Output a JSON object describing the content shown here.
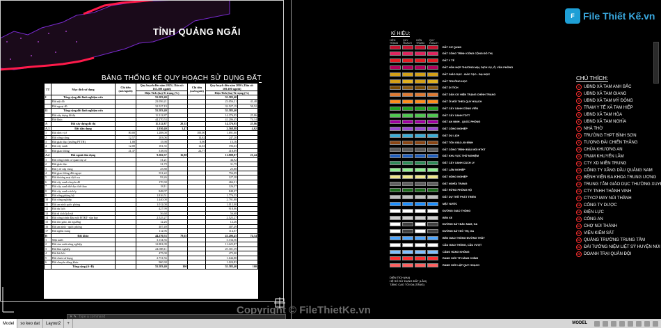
{
  "map": {
    "province_title": "TỈNH QUẢNG NGÃI",
    "table_title": "BẢNG THỐNG KÊ QUY HOẠCH SỬ DỤNG ĐẤT"
  },
  "table": {
    "headers": {
      "stt": "TT",
      "purpose": "Mục đích sử dụng",
      "norm1": "Chỉ tiêu (m2/người)",
      "plan2025": "Quy hoạch đến năm 2025 ( Dân số: 161.100 người)",
      "norm2": "Chỉ tiêu (m2/người)",
      "plan2030": "Quy hoạch đến năm 2030 ( Dân số: 169.100 người)",
      "area_pct": "Diện Tích (ha) Tỉ trọng (%)"
    },
    "rows": [
      [
        "I",
        "Tổng cộng đất lãnh nghiệm cứu",
        "",
        "55.583,40",
        "",
        "",
        "55.583,40",
        "",
        true
      ],
      [
        "",
        "Đất nội đô",
        "",
        "23.056,21",
        "",
        "",
        "23.056,21",
        "41,48",
        false
      ],
      [
        "",
        "Đất ngoại đô",
        "",
        "32.527,19",
        "",
        "",
        "32.527,19",
        "58,52",
        false
      ],
      [
        "II",
        "Tổng cộng đất lãnh nghiệm cứu",
        "",
        "55.583,40",
        "",
        "",
        "55.583,40",
        "",
        true
      ],
      [
        "",
        "Đất xây dựng đô thị",
        "",
        "11.312,87",
        "",
        "",
        "14.376,95",
        "25,86",
        false
      ],
      [
        "",
        "Đất khác",
        "",
        "44.270,53",
        "",
        "",
        "41.206,45",
        "74,14",
        false
      ],
      [
        "A",
        "Đất xây dựng đô thị",
        "",
        "11.312,87",
        "20,35",
        "",
        "14.376,95",
        "25,86",
        true
      ],
      [
        "A.1",
        "Đất dân dụng",
        "",
        "1.930,40",
        "3,47",
        "",
        "2.568,88",
        "4,62",
        true
      ],
      [
        "1",
        "Đất đơn vị ở",
        "80,00",
        "1.288,00",
        "",
        "100,00",
        "1.691,00",
        "",
        false
      ],
      [
        "2",
        "Đất công cộng",
        "12,57",
        "203,06",
        "",
        "14,62",
        "247,20",
        "",
        false
      ],
      [
        "3",
        "Đất giáo dục (trường PTTH)",
        "1,00",
        "15,98",
        "",
        "0,90",
        "15,16",
        "",
        false
      ],
      [
        "4",
        "Đất cây xanh",
        "12,00",
        "181,35",
        "",
        "12,63",
        "196,63",
        "",
        false
      ],
      [
        "5",
        "Đất giao thông",
        "21,37",
        "318,93",
        "",
        "24,77",
        "418,89",
        "",
        false
      ],
      [
        "A.2",
        "Đất ngoài dân dụng",
        "",
        "9.382,37",
        "16,88",
        "",
        "11.808,07",
        "21,24",
        true
      ],
      [
        "1",
        "Đất công trình cơ quan trụ sở",
        "",
        "31,21",
        "",
        "",
        "44,92",
        "",
        false
      ],
      [
        "2",
        "Đất giáo dục",
        "",
        "31,79",
        "",
        "",
        "31,79",
        "",
        false
      ],
      [
        "3",
        "Đất y tế cấp vùng",
        "",
        "25,88",
        "",
        "",
        "25,88",
        "",
        false
      ],
      [
        "4",
        "Đất giao thông đối ngoại",
        "",
        "551,22",
        "",
        "",
        "756,09",
        "",
        false
      ],
      [
        "5",
        "Đất thương mại dịch vụ",
        "",
        "93,26",
        "",
        "",
        "127,38",
        "",
        false
      ],
      [
        "6",
        "Đất cây xanh chuyên đề",
        "",
        "170,30",
        "",
        "",
        "466,31",
        "",
        false
      ],
      [
        "7",
        "Đất cây xanh thể dục thể thao",
        "",
        "18,11",
        "",
        "",
        "126,57",
        "",
        false
      ],
      [
        "8",
        "Đất cây xanh cách ly",
        "",
        "848,07",
        "",
        "",
        "848,07",
        "",
        false
      ],
      [
        "9",
        "Đất rừng phòng hộ",
        "",
        "1.816,51",
        "",
        "",
        "1.776,55",
        "",
        false
      ],
      [
        "10",
        "Đất công nghiệp",
        "",
        "1.440,00",
        "",
        "",
        "2.791,88",
        "",
        false
      ],
      [
        "11",
        "Đất an ninh quốc phòng",
        "",
        "1.012,00",
        "",
        "",
        "1.012,00",
        "",
        false
      ],
      [
        "12",
        "Đất du lịch",
        "",
        "427,99",
        "",
        "",
        "918,86",
        "",
        false
      ],
      [
        "13",
        "Đất di tích lịch sử",
        "",
        "56,68",
        "",
        "",
        "56,68",
        "",
        false
      ],
      [
        "14",
        "Đất công trình đầu mối HTKT- sân bay",
        "",
        "2.525,27",
        "",
        "",
        "2.525,27",
        "",
        false
      ],
      [
        "15",
        "Đất tôn giáo, tín ngưỡng",
        "",
        "12,26",
        "",
        "",
        "12,26",
        "",
        false
      ],
      [
        "16",
        "Đất an ninh - quốc phòng",
        "",
        "407,49",
        "",
        "",
        "407,49",
        "",
        false
      ],
      [
        "17",
        "Đất nghĩa trang",
        "",
        "112,96",
        "",
        "",
        "114,07",
        "",
        false
      ],
      [
        "B",
        "Đất khác",
        "",
        "44.270,53",
        "79,65",
        "",
        "41.206,45",
        "74,14",
        true
      ],
      [
        "1",
        "Mặt nước",
        "",
        "3.134,56",
        "",
        "",
        "3.134,56",
        "",
        false
      ],
      [
        "2",
        "Đất sản xuất nông nghiệp",
        "",
        "12.881,09",
        "",
        "",
        "11.625,87",
        "",
        false
      ],
      [
        "3",
        "Đất lâm nghiệp",
        "",
        "24.088,11",
        "",
        "",
        "25.301,39",
        "",
        false
      ],
      [
        "4",
        "Đất bãi bồi",
        "",
        "475,00",
        "",
        "",
        "475,00",
        "",
        false
      ],
      [
        "5",
        "Đất chưa sử dụng",
        "",
        "2.731,56",
        "",
        "",
        "1.644,80",
        "",
        false
      ],
      [
        "6",
        "Đất chuyên dùng khác",
        "",
        "960,30",
        "",
        "",
        "1.024,83",
        "",
        false
      ],
      [
        "",
        "Tổng cộng (A+B)",
        "",
        "55.583,40",
        "100",
        "",
        "55.583,40",
        "100",
        true
      ]
    ]
  },
  "legend": {
    "title": "KÍ HIỆU:",
    "col_headers": [
      "HIỆN TRẠNG",
      "QUY HOẠCH",
      "HIỆN TRẠNG",
      "QUY HOẠCH"
    ],
    "items": [
      {
        "label": "ĐẤT CƠ QUAN",
        "c1": "#c8102e",
        "c2": "#c8102e"
      },
      {
        "label": "ĐẤT CÔNG TRÌNH CÔNG CỘNG ĐÔ THỊ",
        "c1": "#e0245e",
        "c2": "#e0245e"
      },
      {
        "label": "ĐẤT Y TẾ",
        "c1": "#e31b23",
        "c2": "#e31b23"
      },
      {
        "label": "ĐẤT HỖN HỢP THƯƠNG MẠI, DỊCH VỤ, Ở, VĂN PHÒNG",
        "c1": "#b3005b",
        "c2": "#b3005b"
      },
      {
        "label": "ĐẤT GIÁO DỤC - ĐÀO TẠO - ĐẠI HỌC",
        "c1": "#d4a017",
        "c2": "#d4a017"
      },
      {
        "label": "ĐẤT TRƯỜNG HỌC",
        "c1": "#d4a017",
        "c2": "#e0b020"
      },
      {
        "label": "ĐẤT DI TÍCH",
        "c1": "#7a4b00",
        "c2": "#8a5a10"
      },
      {
        "label": "ĐẤT DÂN CƯ HIỆN TRẠNG CHỈNH TRANG",
        "c1": "#e07a30",
        "c2": "#e07a30"
      },
      {
        "label": "ĐẤT Ở MỚI THEO QUY HOẠCH",
        "c1": "#ff8c1a",
        "c2": "#ff8c1a"
      },
      {
        "label": "ĐẤT CÂY XANH CÔNG VIÊN",
        "c1": "#22a022",
        "c2": "#22a022"
      },
      {
        "label": "ĐẤT CÂY XANH TDTT",
        "c1": "#4fc84f",
        "c2": "#4fc84f"
      },
      {
        "label": "ĐẤT AN NINH - QUỐC PHÒNG",
        "c1": "#a000a0",
        "c2": "#a000a0"
      },
      {
        "label": "ĐẤT CÔNG NGHIỆP",
        "c1": "#9a4ad0",
        "c2": "#9a4ad0"
      },
      {
        "label": "ĐẤT DU LỊCH",
        "c1": "#3aaed8",
        "c2": "#3aaed8"
      },
      {
        "label": "ĐẤT TÔN GIÁO, ĐI ĐÌNH",
        "c1": "#8b4513",
        "c2": "#8b4513"
      },
      {
        "label": "ĐẤT CÔNG TRÌNH ĐẦU MỐI HTKT",
        "c1": "#5b5b5b",
        "c2": "#5b5b5b"
      },
      {
        "label": "ĐẤT KHU VỰC THỬ NGHIỆM",
        "c1": "#2060c0",
        "c2": "#2060c0"
      },
      {
        "label": "ĐẤT CÂY XANH CÁCH LY",
        "c1": "#2e8b57",
        "c2": "#2e8b57"
      },
      {
        "label": "ĐẤT LÂM NGHIỆP",
        "c1": "#90ee90",
        "c2": "#90ee90"
      },
      {
        "label": "ĐẤT NÔNG NGHIỆP",
        "c1": "#f0e68c",
        "c2": "#f0e68c"
      },
      {
        "label": "ĐẤT NGHĨA TRANG",
        "c1": "#606060",
        "c2": "#606060"
      },
      {
        "label": "ĐẤT RỪNG PHÒNG HỘ",
        "c1": "#1a6b1a",
        "c2": "#1a6b1a"
      },
      {
        "label": "ĐẤT DỰ TRỮ PHÁT TRIỂN",
        "c1": "#c0c0c0",
        "c2": "#c0c0c0"
      },
      {
        "label": "MẶT NƯỚC",
        "c1": "#1e90ff",
        "c2": "#1e90ff"
      },
      {
        "label": "ĐƯỜNG GIAO THÔNG",
        "c1": "#ffffff",
        "c2": "#ffffff"
      },
      {
        "label": "BẾN XE",
        "c1": "#d0d0d0",
        "c2": "#d0d0d0"
      },
      {
        "label": "ĐƯỜNG SẮT BẮC NAM, GA",
        "c1": "#ffffff",
        "c2": "#404040"
      },
      {
        "label": "ĐƯỜNG SẮT ĐÔ THỊ, GA",
        "c1": "#ffffff",
        "c2": "#404040"
      },
      {
        "label": "BẾN GIAO THÔNG ĐƯỜNG THỦY",
        "c1": "#4da6ff",
        "c2": "#4da6ff"
      },
      {
        "label": "CẦU GIAO THÔNG, CẦU VƯỢT",
        "c1": "#ffffff",
        "c2": "#ffffff"
      },
      {
        "label": "CẢNG HÀNG KHÔNG",
        "c1": "#80c0ff",
        "c2": "#80c0ff"
      },
      {
        "label": "RANH GIỚI TP HÀNH CHÍNH",
        "c1": "#ff3030",
        "c2": "#ff3030"
      },
      {
        "label": "RANH GIỚI LẬP QUY HOẠCH",
        "c1": "#ff6060",
        "c2": "#ff6060"
      }
    ],
    "density_note": [
      "DIỆN TÍCH (HA)",
      "HỆ SỐ SỬ DỤNG ĐẤT (LẦN)",
      "TẦNG CAO TỐI ĐA (TẦNG)"
    ]
  },
  "notes": {
    "title": "CHÚ THÍCH:",
    "items": [
      {
        "num": "1",
        "label": "UBND XÃ TAM ANH BẮC"
      },
      {
        "num": "2",
        "label": "UBND XÃ TAM GIANG"
      },
      {
        "num": "3",
        "label": "UBND XÃ TAM MỸ ĐÔNG"
      },
      {
        "num": "4",
        "label": "TRẠM Y TẾ XÃ TAM HIỆP"
      },
      {
        "num": "5",
        "label": "UBND XÃ TAM HÒA"
      },
      {
        "num": "6",
        "label": "UBND XÃ TAM NGHĨA"
      },
      {
        "num": "7",
        "label": "NHÀ THỜ"
      },
      {
        "num": "8",
        "label": "TRƯỜNG THPT BÌNH SƠN"
      },
      {
        "num": "9",
        "label": "TƯỢNG ĐÀI CHIẾN THẮNG"
      },
      {
        "num": "10",
        "label": "CHÙA KHƯƠNG AN"
      },
      {
        "num": "11",
        "label": "TRẠM KHUYẾN LÂM"
      },
      {
        "num": "12",
        "label": "CTY XD MIỀN TRUNG"
      },
      {
        "num": "13",
        "label": "CÔNG TY XĂNG DẦU QUẢNG NAM"
      },
      {
        "num": "14",
        "label": "BỆNH VIỆN ĐA KHOA TRUNG ƯƠNG"
      },
      {
        "num": "15",
        "label": "TRUNG TÂM GIÁO DỤC THƯỜNG XUYÊN"
      },
      {
        "num": "16",
        "label": "CTY TNHH THÀNH VINH"
      },
      {
        "num": "17",
        "label": "CTYCP MAY NÚI THÀNH"
      },
      {
        "num": "18",
        "label": "CÔNG TY DƯỢC"
      },
      {
        "num": "19",
        "label": "ĐIỆN LỰC"
      },
      {
        "num": "20",
        "label": "CÔNG AN"
      },
      {
        "num": "21",
        "label": "CHỢ NÚI THÀNH"
      },
      {
        "num": "22",
        "label": "VIỆN KIỂM SÁT"
      },
      {
        "num": "23",
        "label": "QUẢNG TRƯỜNG TRUNG TÂM"
      },
      {
        "num": "24",
        "label": "ĐÀI TƯỞNG NIỆM LIỆT SỸ HUYỆN NÚI THÀNH"
      },
      {
        "num": "25",
        "label": "DOANH TRẠI QUÂN ĐỘI"
      }
    ]
  },
  "branding": {
    "logo_mark": "F",
    "logo_text": "File Thiết Kế.vn",
    "watermark": "Copyright © FileThietKe.vn"
  },
  "statusbar": {
    "tabs": [
      "Model",
      "so keo dat",
      "Layout2",
      "+"
    ],
    "cmd_prompt": "Type a command",
    "model_label": "MODEL"
  },
  "colors": {
    "map_boundary": "#ff1a4a",
    "region_outline": "#7a2ad0"
  }
}
